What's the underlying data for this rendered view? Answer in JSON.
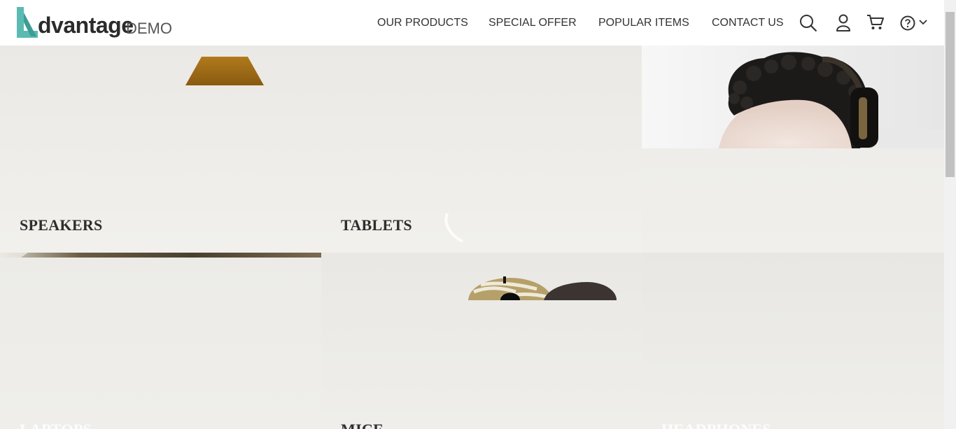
{
  "header": {
    "logo_word": "dvantage",
    "logo_sub": "DEMO",
    "nav": [
      "OUR PRODUCTS",
      "SPECIAL OFFER",
      "POPULAR ITEMS",
      "CONTACT US"
    ]
  },
  "icons": {
    "search": "search-icon",
    "user": "user-icon",
    "cart": "cart-icon",
    "help": "help-icon",
    "chevron": "chevron-down-icon"
  },
  "categories": {
    "speakers": "SPEAKERS",
    "tablets": "TABLETS",
    "laptops": "LAPTOPS",
    "mice": "MICE",
    "headphones": "HEADPHONES"
  },
  "colors": {
    "brand_teal": "#5bbbb2",
    "text_dark": "#2e2e2e"
  }
}
